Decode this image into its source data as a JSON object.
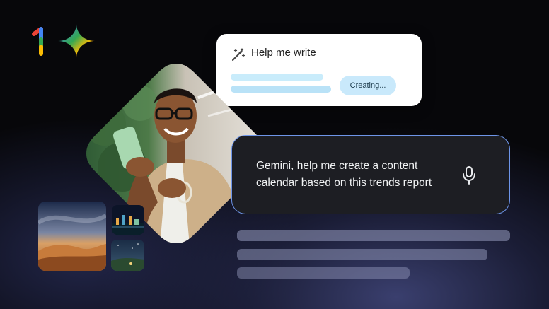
{
  "logo": {
    "icon": "google-one-gemini-logo-icon"
  },
  "write_card": {
    "title": "Help me write",
    "icon": "magic-pen-icon",
    "status_button": "Creating..."
  },
  "prompt_card": {
    "text": "Gemini, help me create a content calendar based on this trends report",
    "icon": "microphone-icon"
  },
  "colors": {
    "background": "#07070a",
    "accent_border": "#6e95e8",
    "creating_button": "#c9e9fb",
    "card_bg": "#1d1e23"
  }
}
